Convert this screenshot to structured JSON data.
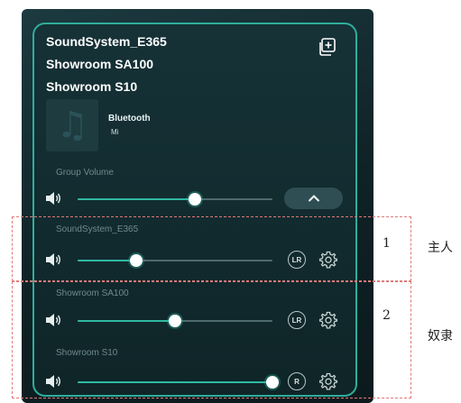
{
  "group": {
    "names": [
      "SoundSystem_E365",
      "Showroom SA100",
      "Showroom S10"
    ],
    "group_icon": "add-group-icon"
  },
  "now_playing": {
    "source": "Bluetooth",
    "subtitle": "Mi",
    "art_icon": "music-note-icon"
  },
  "group_volume": {
    "label": "Group Volume",
    "level": 0.6,
    "expand_icon": "chevron-up-icon"
  },
  "devices": [
    {
      "name": "SoundSystem_E365",
      "level": 0.3,
      "channel": "LR",
      "settings_icon": "gear-icon"
    },
    {
      "name": "Showroom SA100",
      "level": 0.5,
      "channel": "LR",
      "settings_icon": "gear-icon"
    },
    {
      "name": "Showroom S10",
      "level": 1.0,
      "channel": "R",
      "settings_icon": "gear-icon"
    }
  ],
  "annotations": {
    "box1_number": "1",
    "box1_label": "主人",
    "box2_number": "2",
    "box2_label": "奴隶"
  },
  "colors": {
    "accent": "#2fb8a3",
    "border": "#2fae9c",
    "background": "#112a2e",
    "annotation_box": "#e07a7a"
  }
}
